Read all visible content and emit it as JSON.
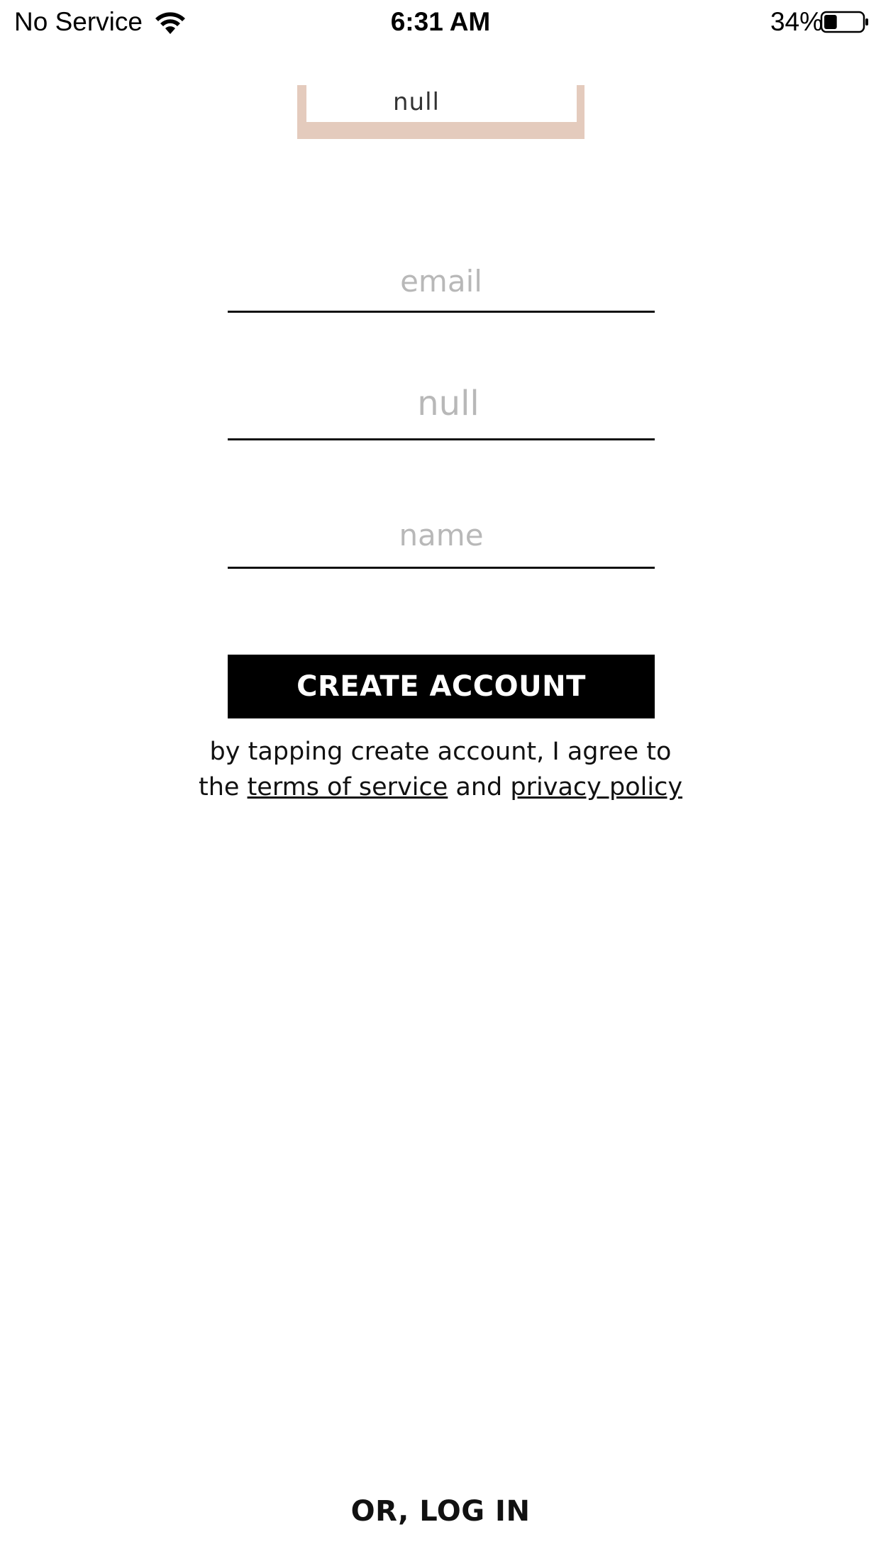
{
  "status_bar": {
    "carrier": "No Service",
    "time": "6:31 AM",
    "battery_percent": "34%",
    "battery_level": 0.34,
    "wifi_icon": "wifi-icon",
    "battery_icon": "battery-icon"
  },
  "logo": {
    "text": "null",
    "accent_color": "#e4cbbd"
  },
  "form": {
    "email_placeholder": "email",
    "null_placeholder": "null",
    "name_placeholder": "name",
    "email_value": "",
    "null_value": "",
    "name_value": ""
  },
  "actions": {
    "create_account_label": "CREATE ACCOUNT",
    "login_label": "OR, LOG IN"
  },
  "legal": {
    "line1": "by tapping create account, I agree to",
    "the": "the",
    "terms_label": "terms of service",
    "and": "and",
    "privacy_label": "privacy policy"
  },
  "colors": {
    "primary_button": "#000000",
    "placeholder": "#b8b8b8"
  }
}
